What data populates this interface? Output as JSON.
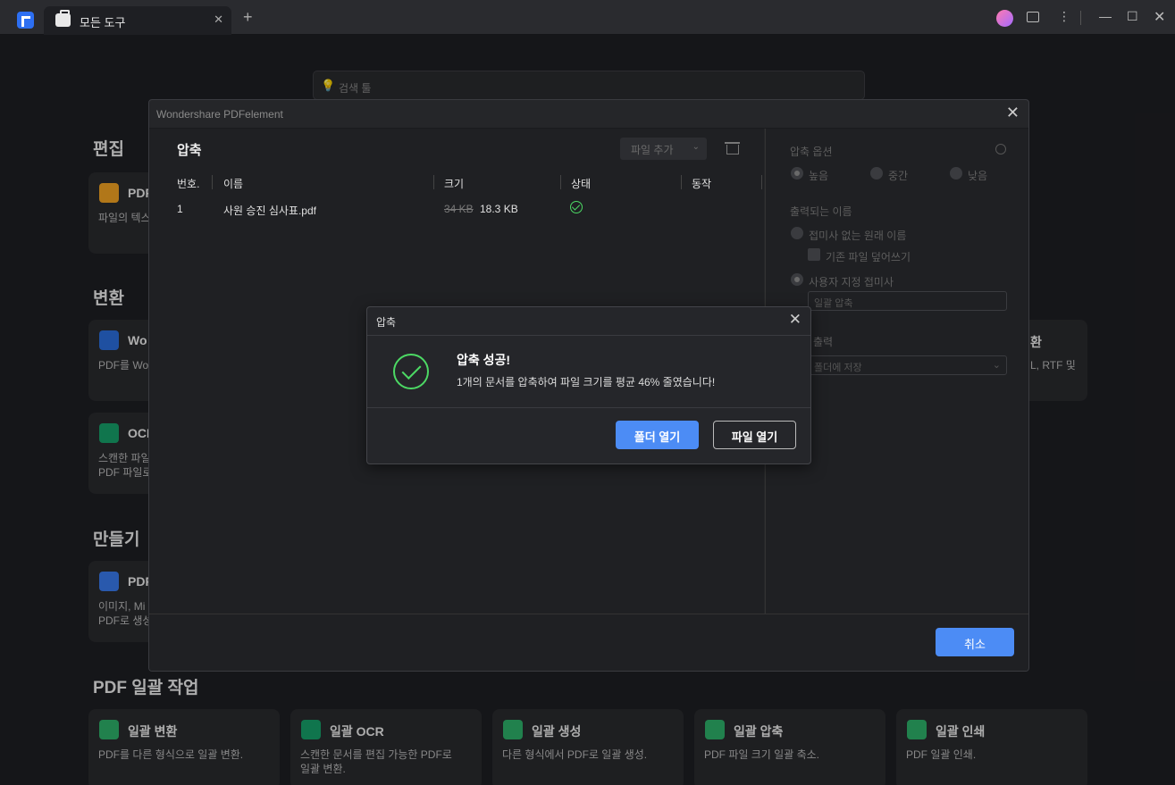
{
  "tab": {
    "title": "모든 도구"
  },
  "search": {
    "placeholder": "검색 툴"
  },
  "sections": {
    "edit": "편집",
    "convert": "변환",
    "create": "만들기",
    "batch": "PDF 일괄 작업"
  },
  "cards": {
    "edit_pdf": {
      "title": "PDF",
      "desc": "파일의 텍스"
    },
    "to_word": {
      "title": "Wo",
      "desc": "PDF를 Wo"
    },
    "ocr": {
      "title": "OCR",
      "desc": "스캔한 파일\nPDF 파일로"
    },
    "convert_right": {
      "title": "환",
      "desc": "L, RTF 및"
    },
    "create_pdf": {
      "title": "PDF",
      "desc": "이미지, Mi\nPDF로 생성"
    },
    "batch_convert": {
      "title": "일괄 변환",
      "desc": "PDF를 다른 형식으로 일괄 변환."
    },
    "batch_ocr": {
      "title": "일괄 OCR",
      "desc": "스캔한 문서를 편집 가능한 PDF로\n일괄 변환."
    },
    "batch_create": {
      "title": "일괄 생성",
      "desc": "다른 형식에서 PDF로 일괄 생성."
    },
    "batch_compress": {
      "title": "일괄 압축",
      "desc": "PDF 파일 크기 일괄 축소."
    },
    "batch_print": {
      "title": "일괄 인쇄",
      "desc": "PDF 일괄 인쇄."
    }
  },
  "main_window": {
    "title": "Wondershare PDFelement",
    "panel_title": "압축",
    "add_file": "파일 추가",
    "columns": [
      "번호.",
      "이름",
      "크기",
      "상태",
      "동작"
    ],
    "rows": [
      {
        "num": "1",
        "name": "사원 승진 심사표.pdf",
        "old_size": "34 KB",
        "new_size": "18.3 KB"
      }
    ],
    "options": {
      "title": "압축 옵션",
      "quality": [
        "높음",
        "중간",
        "낮음"
      ],
      "output_name_label": "출력되는 이름",
      "original_name": "접미사 없는 원래 이름",
      "overwrite": "기존 파일 덮어쓰기",
      "custom_suffix": "사용자 지정 접미사",
      "suffix_value": "일괄 압축",
      "output_label": "출력",
      "output_value": "폴더에 저장"
    },
    "cancel": "취소"
  },
  "dialog": {
    "title": "압축",
    "message_title": "압축 성공!",
    "message": "1개의 문서를 압축하여 파일 크기를 평균 46% 줄였습니다!",
    "open_folder": "폴더 열기",
    "open_file": "파일 열기"
  },
  "colors": {
    "accent": "#4c8cf5",
    "success": "#4cd964",
    "background": "#1e1f23"
  }
}
